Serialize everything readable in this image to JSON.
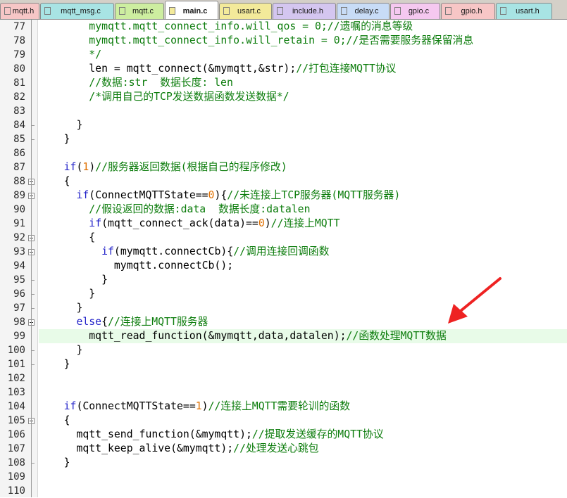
{
  "tabs": [
    {
      "label": "mqtt.h",
      "color": "#f7c6c6",
      "active": false
    },
    {
      "label": "mqtt_msg.c",
      "color": "#a8e4e4",
      "active": false
    },
    {
      "label": "mqtt.c",
      "color": "#cdeea0",
      "active": false
    },
    {
      "label": "main.c",
      "color": "#f3ea9a",
      "active": true
    },
    {
      "label": "usart.c",
      "color": "#f3ea9a",
      "active": false
    },
    {
      "label": "include.h",
      "color": "#d4c6f0",
      "active": false
    },
    {
      "label": "delay.c",
      "color": "#c8dcf7",
      "active": false
    },
    {
      "label": "gpio.c",
      "color": "#f5c8f0",
      "active": false
    },
    {
      "label": "gpio.h",
      "color": "#f7c6c6",
      "active": false
    },
    {
      "label": "usart.h",
      "color": "#a8e4e4",
      "active": false
    }
  ],
  "editor": {
    "lines": [
      {
        "num": "77",
        "fold": "",
        "segs": [
          {
            "t": "        "
          },
          {
            "t": "mymqtt.mqtt_connect_info.will_qos = 0;//遗嘱的消息等级",
            "c": "cm"
          }
        ]
      },
      {
        "num": "78",
        "fold": "",
        "segs": [
          {
            "t": "        "
          },
          {
            "t": "mymqtt.mqtt_connect_info.will_retain = 0;//是否需要服务器保留消息",
            "c": "cm"
          }
        ]
      },
      {
        "num": "79",
        "fold": "",
        "segs": [
          {
            "t": "        "
          },
          {
            "t": "*/",
            "c": "cm"
          }
        ]
      },
      {
        "num": "80",
        "fold": "",
        "segs": [
          {
            "t": "        len = mqtt_connect(&mymqtt,&str);"
          },
          {
            "t": "//打包连接MQTT协议",
            "c": "cm"
          }
        ]
      },
      {
        "num": "81",
        "fold": "",
        "segs": [
          {
            "t": "        "
          },
          {
            "t": "//数据:str  数据长度: len",
            "c": "cm"
          }
        ]
      },
      {
        "num": "82",
        "fold": "",
        "segs": [
          {
            "t": "        "
          },
          {
            "t": "/*调用自己的TCP发送数据函数发送数据*/",
            "c": "cm"
          }
        ]
      },
      {
        "num": "83",
        "fold": "",
        "segs": [
          {
            "t": ""
          }
        ]
      },
      {
        "num": "84",
        "fold": "end",
        "segs": [
          {
            "t": "      }"
          }
        ]
      },
      {
        "num": "85",
        "fold": "end",
        "segs": [
          {
            "t": "    }"
          }
        ]
      },
      {
        "num": "86",
        "fold": "",
        "segs": [
          {
            "t": ""
          }
        ]
      },
      {
        "num": "87",
        "fold": "",
        "segs": [
          {
            "t": "    "
          },
          {
            "t": "if",
            "c": "kw"
          },
          {
            "t": "("
          },
          {
            "t": "1",
            "c": "nm"
          },
          {
            "t": ")"
          },
          {
            "t": "//服务器返回数据(根据自己的程序修改)",
            "c": "cm"
          }
        ]
      },
      {
        "num": "88",
        "fold": "box",
        "segs": [
          {
            "t": "    {"
          }
        ]
      },
      {
        "num": "89",
        "fold": "box",
        "segs": [
          {
            "t": "      "
          },
          {
            "t": "if",
            "c": "kw"
          },
          {
            "t": "(ConnectMQTTState=="
          },
          {
            "t": "0",
            "c": "nm"
          },
          {
            "t": "){"
          },
          {
            "t": "//未连接上TCP服务器(MQTT服务器)",
            "c": "cm"
          }
        ]
      },
      {
        "num": "90",
        "fold": "",
        "segs": [
          {
            "t": "        "
          },
          {
            "t": "//假设返回的数据:data  数据长度:datalen",
            "c": "cm"
          }
        ]
      },
      {
        "num": "91",
        "fold": "",
        "segs": [
          {
            "t": "        "
          },
          {
            "t": "if",
            "c": "kw"
          },
          {
            "t": "(mqtt_connect_ack(data)=="
          },
          {
            "t": "0",
            "c": "nm"
          },
          {
            "t": ")"
          },
          {
            "t": "//连接上MQTT",
            "c": "cm"
          }
        ]
      },
      {
        "num": "92",
        "fold": "box",
        "segs": [
          {
            "t": "        {"
          }
        ]
      },
      {
        "num": "93",
        "fold": "box",
        "segs": [
          {
            "t": "          "
          },
          {
            "t": "if",
            "c": "kw"
          },
          {
            "t": "(mymqtt.connectCb){"
          },
          {
            "t": "//调用连接回调函数",
            "c": "cm"
          }
        ]
      },
      {
        "num": "94",
        "fold": "",
        "segs": [
          {
            "t": "            mymqtt.connectCb();"
          }
        ]
      },
      {
        "num": "95",
        "fold": "end",
        "segs": [
          {
            "t": "          }"
          }
        ]
      },
      {
        "num": "96",
        "fold": "end",
        "segs": [
          {
            "t": "        }"
          }
        ]
      },
      {
        "num": "97",
        "fold": "end",
        "segs": [
          {
            "t": "      }"
          }
        ]
      },
      {
        "num": "98",
        "fold": "box",
        "segs": [
          {
            "t": "      "
          },
          {
            "t": "else",
            "c": "kw"
          },
          {
            "t": "{"
          },
          {
            "t": "//连接上MQTT服务器",
            "c": "cm"
          }
        ]
      },
      {
        "num": "99",
        "fold": "",
        "segs": [
          {
            "t": "        mqtt_read_function(&mymqtt,data,datalen);"
          },
          {
            "t": "//函数处理MQTT数据",
            "c": "cm"
          }
        ]
      },
      {
        "num": "100",
        "fold": "end",
        "segs": [
          {
            "t": "      }"
          }
        ]
      },
      {
        "num": "101",
        "fold": "end",
        "segs": [
          {
            "t": "    }"
          }
        ]
      },
      {
        "num": "102",
        "fold": "",
        "segs": [
          {
            "t": ""
          }
        ]
      },
      {
        "num": "103",
        "fold": "",
        "segs": [
          {
            "t": ""
          }
        ]
      },
      {
        "num": "104",
        "fold": "",
        "segs": [
          {
            "t": "    "
          },
          {
            "t": "if",
            "c": "kw"
          },
          {
            "t": "(ConnectMQTTState=="
          },
          {
            "t": "1",
            "c": "nm"
          },
          {
            "t": ")"
          },
          {
            "t": "//连接上MQTT需要轮训的函数",
            "c": "cm"
          }
        ]
      },
      {
        "num": "105",
        "fold": "box",
        "segs": [
          {
            "t": "    {"
          }
        ]
      },
      {
        "num": "106",
        "fold": "",
        "segs": [
          {
            "t": "      mqtt_send_function(&mymqtt);"
          },
          {
            "t": "//提取发送缓存的MQTT协议",
            "c": "cm"
          }
        ]
      },
      {
        "num": "107",
        "fold": "",
        "segs": [
          {
            "t": "      mqtt_keep_alive(&mymqtt);"
          },
          {
            "t": "//处理发送心跳包",
            "c": "cm"
          }
        ]
      },
      {
        "num": "108",
        "fold": "end",
        "segs": [
          {
            "t": "    }"
          }
        ]
      },
      {
        "num": "109",
        "fold": "",
        "segs": [
          {
            "t": ""
          }
        ]
      },
      {
        "num": "110",
        "fold": "",
        "segs": [
          {
            "t": ""
          }
        ]
      }
    ],
    "highlighted_line": "99",
    "colors": {
      "comment": "#0d7d0d",
      "keyword": "#1f1fc8",
      "number": "#e07000",
      "arrow": "#ee2222",
      "highlight": "#e8fbe8"
    }
  },
  "annotation": {
    "icon": "red-arrow-icon"
  }
}
